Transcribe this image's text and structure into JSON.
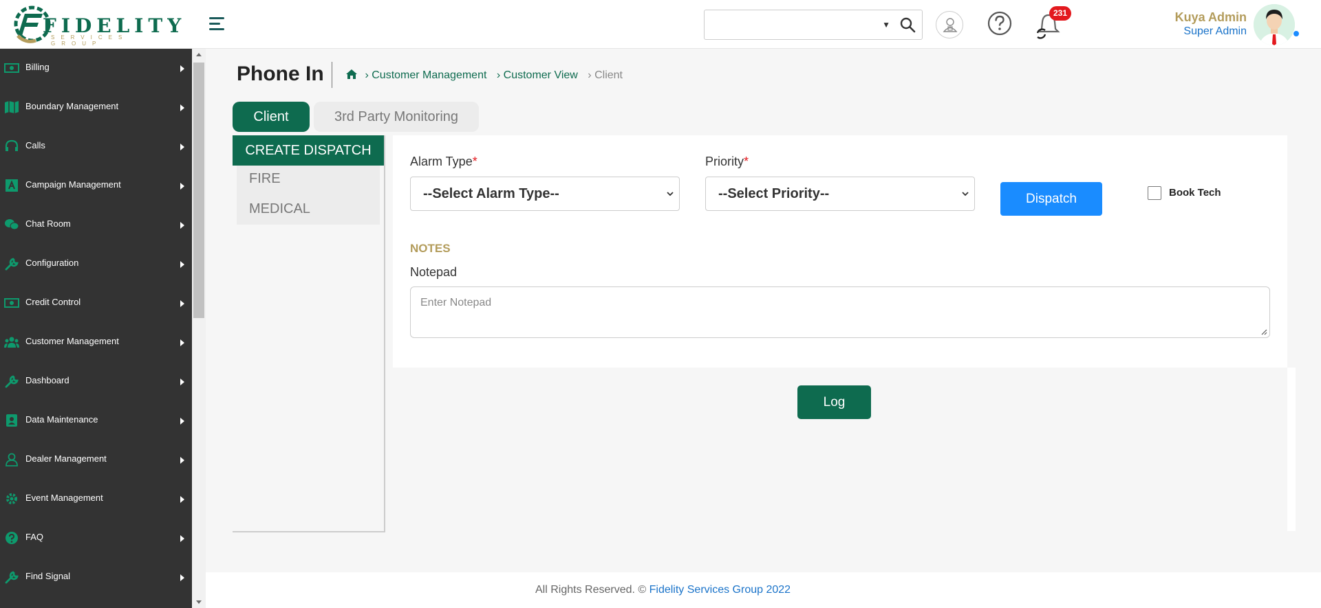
{
  "brand": {
    "logo_word": "FIDELITY",
    "logo_sub": "SERVICES GROUP"
  },
  "header": {
    "search": {
      "placeholder": "",
      "value": ""
    },
    "notifications_count": "231",
    "user": {
      "name": "Kuya Admin",
      "role": "Super Admin"
    }
  },
  "sidebar": {
    "items": [
      {
        "label": "Billing",
        "icon": "money-icon"
      },
      {
        "label": "Boundary Management",
        "icon": "map-icon"
      },
      {
        "label": "Calls",
        "icon": "headset-icon"
      },
      {
        "label": "Campaign Management",
        "icon": "campaign-icon"
      },
      {
        "label": "Chat Room",
        "icon": "chat-icon"
      },
      {
        "label": "Configuration",
        "icon": "wrench-icon"
      },
      {
        "label": "Credit Control",
        "icon": "money-icon"
      },
      {
        "label": "Customer Management",
        "icon": "users-icon"
      },
      {
        "label": "Dashboard",
        "icon": "wrench-icon"
      },
      {
        "label": "Data Maintenance",
        "icon": "id-card-icon"
      },
      {
        "label": "Dealer Management",
        "icon": "user-icon"
      },
      {
        "label": "Event Management",
        "icon": "gear-icon"
      },
      {
        "label": "FAQ",
        "icon": "question-icon"
      },
      {
        "label": "Find Signal",
        "icon": "wrench-icon"
      }
    ]
  },
  "page": {
    "title": "Phone In",
    "breadcrumb": [
      "Customer Management",
      "Customer View",
      "Client"
    ]
  },
  "tabs": {
    "client": "Client",
    "third_party": "3rd Party Monitoring"
  },
  "dispatch_panel": {
    "header": "CREATE DISPATCH",
    "items": [
      "FIRE",
      "MEDICAL"
    ]
  },
  "form": {
    "alarm_type_label": "Alarm Type",
    "alarm_type_value": "--Select Alarm Type--",
    "priority_label": "Priority",
    "priority_value": "--Select Priority--",
    "required_mark": "*",
    "dispatch_button": "Dispatch",
    "book_tech_label": "Book Tech",
    "book_tech_checked": false,
    "notes_heading": "NOTES",
    "notepad_label": "Notepad",
    "notepad_placeholder": "Enter Notepad"
  },
  "log_button": "Log",
  "footer": {
    "text": "All Rights Reserved. © ",
    "link": "Fidelity Services Group 2022"
  },
  "colors": {
    "primary_green": "#0e6b4f",
    "gold": "#b39c5b",
    "blue": "#1a8cff",
    "sidebar_bg": "#333333",
    "badge_red": "#e3191e"
  }
}
